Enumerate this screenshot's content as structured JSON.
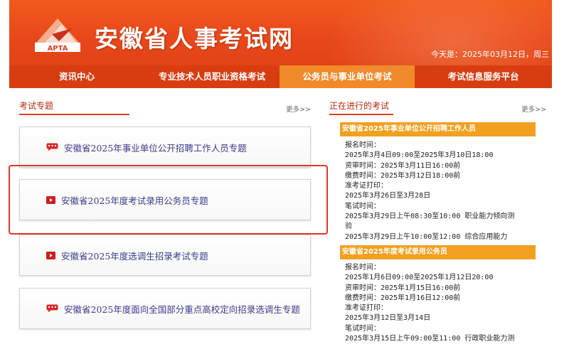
{
  "header": {
    "logo_text": "APTA",
    "site_title": "安徽省人事考试网",
    "date_text": "今天是：2025年03月12日，周三"
  },
  "nav": {
    "items": [
      {
        "label": "资讯中心"
      },
      {
        "label": "专业技术人员职业资格考试"
      },
      {
        "label": "公务员与事业单位考试"
      },
      {
        "label": "考试信息服务平台"
      }
    ]
  },
  "left_panel": {
    "title": "考试专题",
    "more": "更多>>",
    "topics": [
      {
        "label": "安徽省2025年事业单位公开招聘工作人员专题",
        "icon": "speech-bubble-icon"
      },
      {
        "label": "安徽省2025年度考试录用公务员专题",
        "icon": "play-icon"
      },
      {
        "label": "安徽省2025年度选调生招录考试专题",
        "icon": "play-icon"
      },
      {
        "label": "安徽省2025年度面向全国部分重点高校定向招录选调生专题",
        "icon": "speech-bubble-icon"
      }
    ]
  },
  "right_panel": {
    "title": "正在进行的考试",
    "more": "更多>>",
    "exams": [
      {
        "name": "安徽省2025年事业单位公开招聘工作人员",
        "lines": [
          "报名时间：",
          "2025年3月4日09:00至2025年3月10日18:00",
          "资审时间：2025年3月11日16:00前",
          "缴费时间：2025年3月12日18:00前",
          "准考证打印：",
          "2025年3月26日至3月28日",
          "笔试时间：",
          "2025年3月29日上午08:30至10:00 职业能力倾向测",
          "验",
          "2025年3月29日上午10:00至12:00 综合应用能力"
        ]
      },
      {
        "name": "安徽省2025年度考试录用公务员",
        "lines": [
          "报名时间：",
          "2025年1月6日09:00至2025年1月12日20:00",
          "资审时间：2025年1月15日16:00前",
          "缴费时间：2025年1月16日12:00前",
          "准考证打印：",
          "2025年3月12日至3月14日",
          "笔试时间：",
          "2025年3月15日上午09:00至11:00 行政职业能力测"
        ]
      }
    ]
  },
  "colors": {
    "header_orange": "#e8471a",
    "nav_red": "#d83d12",
    "nav_active": "#f08a2a",
    "exam_header": "#f2a020",
    "highlight_red": "#e1342b"
  }
}
